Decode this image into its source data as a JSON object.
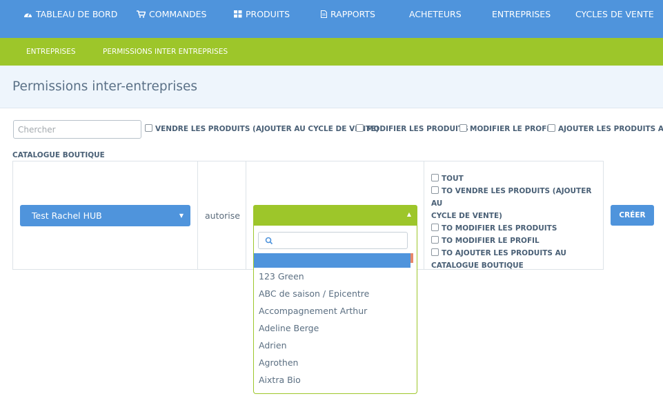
{
  "topnav": {
    "items": [
      {
        "label": "TABLEAU DE BORD",
        "icon": "dashboard-icon"
      },
      {
        "label": "COMMANDES",
        "icon": "cart-icon"
      },
      {
        "label": "PRODUITS",
        "icon": "grid-icon"
      },
      {
        "label": "RAPPORTS",
        "icon": "document-icon"
      },
      {
        "label": "ACHETEURS"
      },
      {
        "label": "ENTREPRISES"
      },
      {
        "label": "CYCLES DE VENTE"
      }
    ]
  },
  "subnav": {
    "items": [
      {
        "label": "ENTREPRISES"
      },
      {
        "label": "PERMISSIONS INTER ENTREPRISES",
        "active": true
      }
    ]
  },
  "page": {
    "title": "Permissions inter-entreprises"
  },
  "filters": {
    "search_placeholder": "Chercher",
    "checkboxes": [
      "VENDRE LES PRODUITS (AJOUTER AU CYCLE DE VENTE)",
      "MODIFIER LES PRODUITS",
      "MODIFIER LE PROFIL",
      "AJOUTER LES PRODUITS AU"
    ],
    "wrapped_label": "CATALOGUE BOUTIQUE"
  },
  "row": {
    "company_select": "Test Rachel HUB",
    "status": "autorise",
    "target_select": "",
    "dropdown_options": [
      "123 Green",
      "ABC de saison / Epicentre",
      "Accompagnement Arthur",
      "Adeline Berge",
      "Adrien",
      "Agrothen",
      "Aixtra Bio"
    ],
    "permissions": [
      "TOUT",
      "TO VENDRE LES PRODUITS (AJOUTER AU",
      "CYCLE DE VENTE)",
      "TO MODIFIER LES PRODUITS",
      "TO MODIFIER LE PROFIL",
      "TO AJOUTER LES PRODUITS AU",
      "CATALOGUE BOUTIQUE"
    ],
    "create_label": "CRÉER"
  },
  "colors": {
    "primary": "#4f94dc",
    "accent": "#9dc62a",
    "header_bg": "#eef5fc"
  }
}
